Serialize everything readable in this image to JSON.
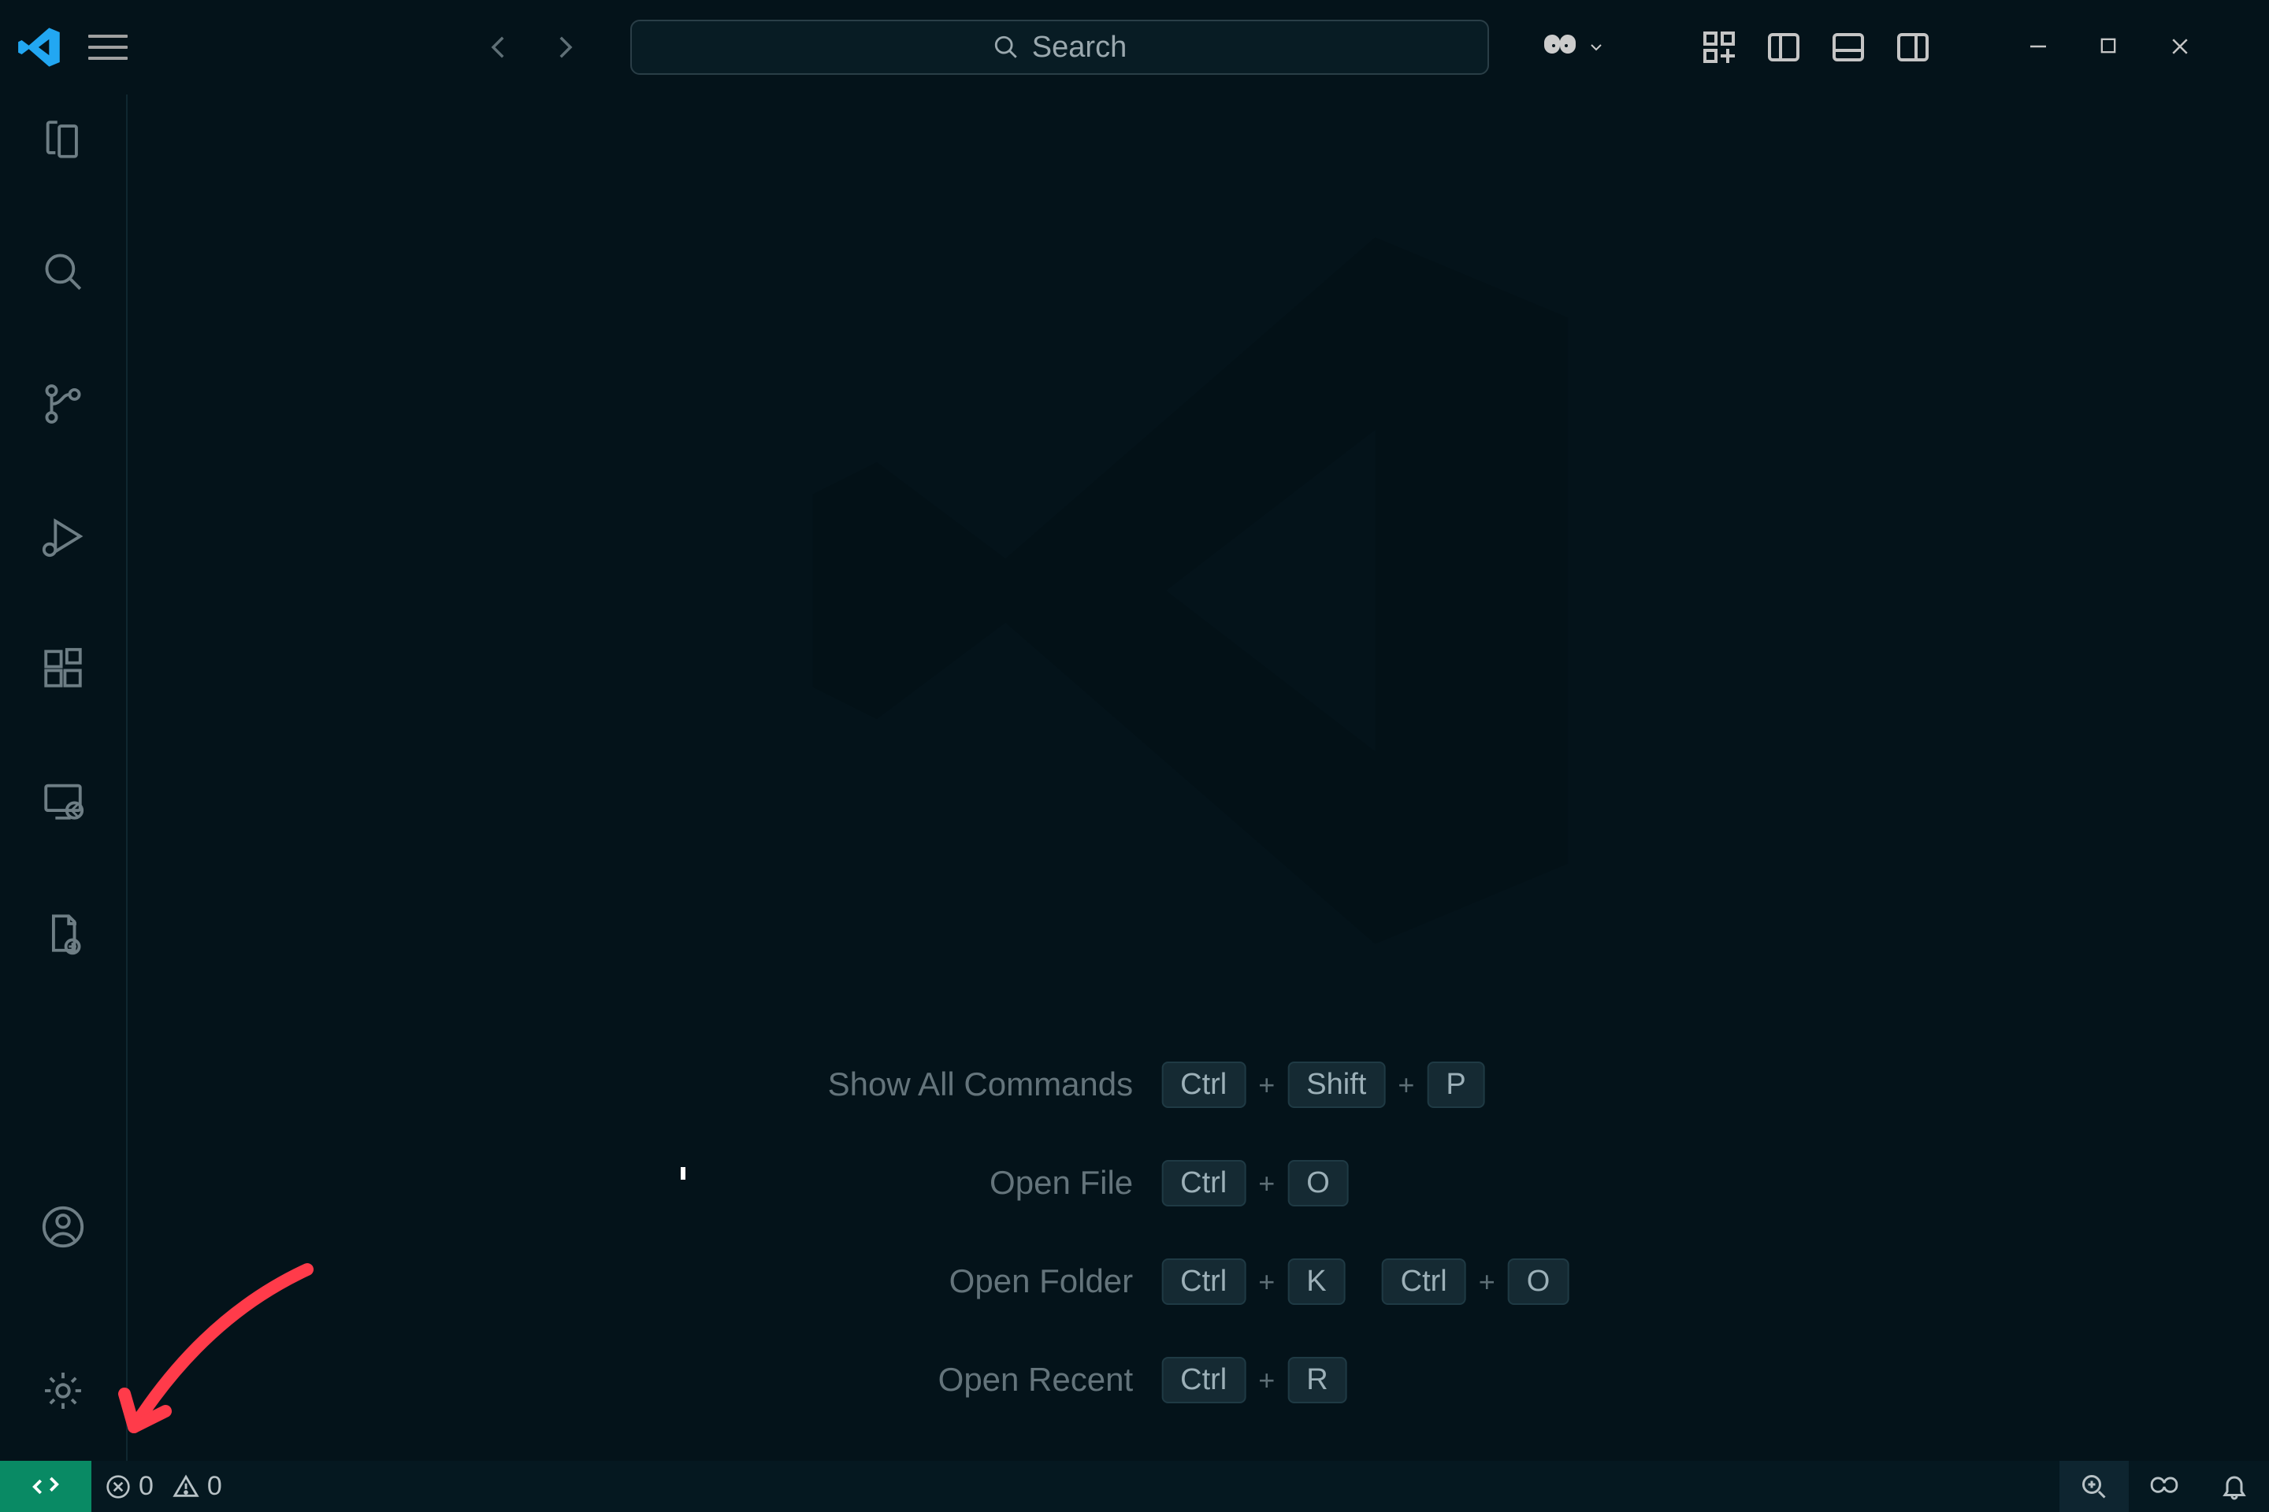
{
  "title_bar": {
    "search_placeholder": "Search"
  },
  "activity_bar": {
    "items_top": [
      "explorer",
      "search",
      "source-control",
      "run-debug",
      "extensions",
      "remote-explorer",
      "cmake"
    ],
    "items_bottom": [
      "accounts",
      "manage"
    ]
  },
  "shortcuts": [
    {
      "label": "Show All Commands",
      "keys": [
        "Ctrl",
        "Shift",
        "P"
      ]
    },
    {
      "label": "Open File",
      "keys": [
        "Ctrl",
        "O"
      ]
    },
    {
      "label": "Open Folder",
      "keys": [
        "Ctrl",
        "K",
        "Ctrl",
        "O"
      ]
    },
    {
      "label": "Open Recent",
      "keys": [
        "Ctrl",
        "R"
      ]
    }
  ],
  "status_bar": {
    "errors": "0",
    "warnings": "0"
  },
  "annotation": {
    "color": "#ff3b4a",
    "target": "manage-gear-icon"
  }
}
